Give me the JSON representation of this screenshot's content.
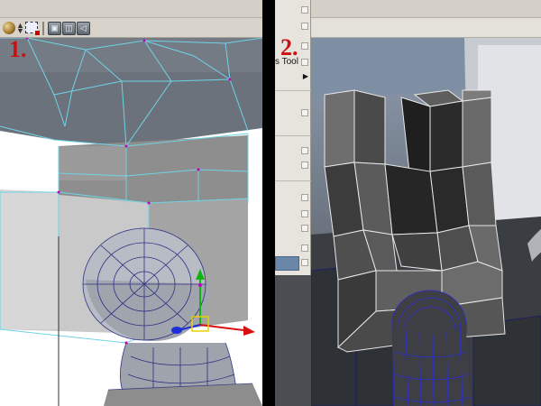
{
  "labels": {
    "step1": "1.",
    "step2": "2."
  },
  "panel1": {
    "toolbar_icons": [
      "shaded-sphere-icon",
      "updown-arrows-icon",
      "lasso-select-icon",
      "cube-view-icon",
      "isolate-view-icon",
      "render-view-icon"
    ],
    "manipulator_colors": {
      "x_axis": "#d81010",
      "y_axis": "#13b313",
      "z_axis": "#1e2fd8",
      "pivot": "#e8d000",
      "wire": "#6fd3e6"
    }
  },
  "panel2": {
    "menu": {
      "items": [
        {
          "label": "",
          "checkbox": true
        },
        {
          "label": "",
          "checkbox": true
        },
        {
          "label": "",
          "checkbox": true
        },
        {
          "label": "s Tool",
          "checkbox": true
        },
        {
          "label": "",
          "submenu": true
        },
        {
          "label": "",
          "checkbox": true
        },
        {
          "label": "",
          "checkbox": true
        },
        {
          "label": "",
          "checkbox": true
        },
        {
          "label": "",
          "checkbox": true
        },
        {
          "label": "",
          "checkbox": true
        },
        {
          "label": "",
          "checkbox": true
        },
        {
          "label": "",
          "checkbox": true
        },
        {
          "label": "",
          "checkbox": true
        },
        {
          "label": "",
          "checkbox": true
        }
      ]
    }
  }
}
